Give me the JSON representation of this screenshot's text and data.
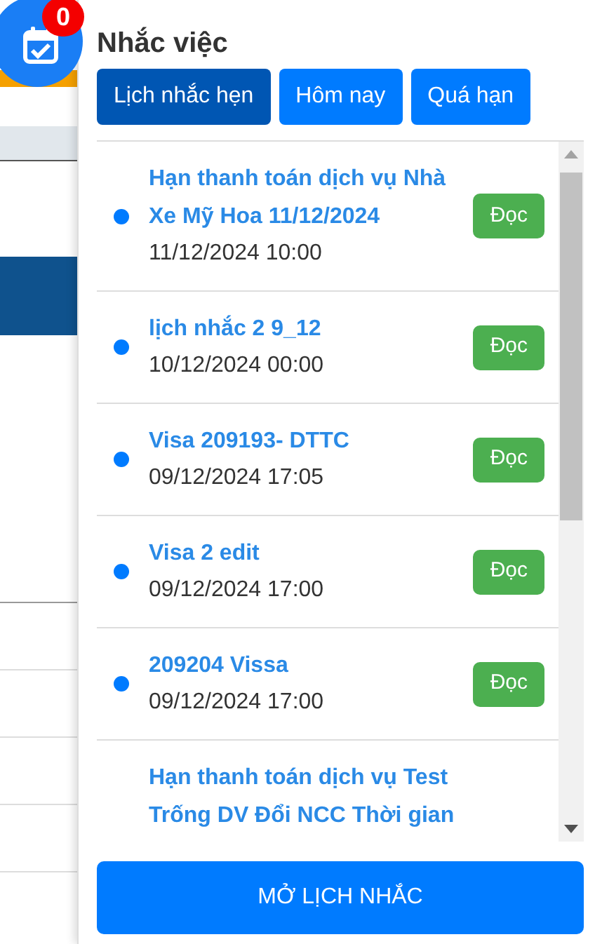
{
  "reminder_button": {
    "badge": "0"
  },
  "panel": {
    "title": "Nhắc việc",
    "tabs": [
      {
        "label": "Lịch nhắc hẹn",
        "selected": true
      },
      {
        "label": "Hôm nay",
        "selected": false
      },
      {
        "label": "Quá hạn",
        "selected": false
      }
    ],
    "items": [
      {
        "title": "Hạn thanh toán dịch vụ Nhà Xe Mỹ Hoa 11/12/2024",
        "time": "11/12/2024 10:00",
        "unread": true,
        "button": "Đọc"
      },
      {
        "title": "lịch nhắc 2 9_12",
        "time": "10/12/2024 00:00",
        "unread": true,
        "button": "Đọc"
      },
      {
        "title": "Visa 209193- DTTC",
        "time": "09/12/2024 17:05",
        "unread": true,
        "button": "Đọc"
      },
      {
        "title": "Visa 2 edit",
        "time": "09/12/2024 17:00",
        "unread": true,
        "button": "Đọc"
      },
      {
        "title": "209204 Vissa",
        "time": "09/12/2024 17:00",
        "unread": true,
        "button": "Đọc"
      },
      {
        "title": "Hạn thanh toán dịch vụ Test Trống DV Đổi NCC Thời gian",
        "unread": false
      }
    ],
    "open_button": "MỞ LỊCH NHẮC"
  }
}
